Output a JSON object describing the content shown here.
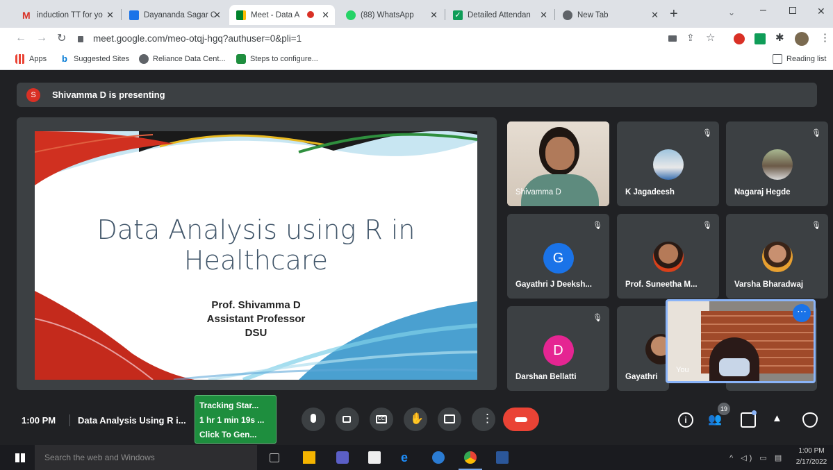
{
  "browser": {
    "tabs": [
      {
        "label": "induction TT for yo",
        "icon": "gmail-icon",
        "color": "#d93025"
      },
      {
        "label": "Dayananda Sagar C",
        "icon": "calendar-icon",
        "color": "#1a73e8"
      },
      {
        "label": "Meet - Data A",
        "icon": "meet-icon",
        "color": "#00832d"
      },
      {
        "label": "(88) WhatsApp",
        "icon": "whatsapp-icon",
        "color": "#25d366"
      },
      {
        "label": "Detailed Attendan",
        "icon": "check-icon",
        "color": "#0f9d58"
      },
      {
        "label": "New Tab",
        "icon": "chrome-icon",
        "color": "#5f6368"
      }
    ],
    "url": "meet.google.com/meo-otqj-hgq?authuser=0&pli=1",
    "bookmarks": [
      "Apps",
      "Suggested Sites",
      "Reliance Data Cent...",
      "Steps to configure..."
    ],
    "reading_list": "Reading list"
  },
  "meet": {
    "presenting_banner": "Shivamma D is presenting",
    "presenter_initial": "S",
    "slide": {
      "title_line1": "Data Analysis using R in",
      "title_line2": "Healthcare",
      "author": "Prof. Shivamma D",
      "role": "Assistant Professor",
      "org": "DSU"
    },
    "participants": [
      {
        "name": "Shivamma D",
        "type": "video",
        "muted": false
      },
      {
        "name": "K Jagadeesh",
        "type": "photo",
        "muted": true
      },
      {
        "name": "Nagaraj Hegde",
        "type": "photo",
        "muted": true
      },
      {
        "name": "Gayathri J Deeksh...",
        "type": "letter",
        "letter": "G",
        "color": "#1a73e8",
        "muted": true
      },
      {
        "name": "Prof. Suneetha M...",
        "type": "photo",
        "muted": true
      },
      {
        "name": "Varsha Bharadwaj",
        "type": "photo",
        "muted": true
      },
      {
        "name": "Darshan Bellatti",
        "type": "letter",
        "letter": "D",
        "color": "#e52592",
        "muted": true
      },
      {
        "name": "Gayathri",
        "type": "photo",
        "muted": false
      }
    ],
    "self_label": "You",
    "time": "1:00 PM",
    "meeting_title": "Data Analysis Using R i...",
    "tracker": {
      "line1": "Tracking Star...",
      "line2": "1 hr 1 min 19s ...",
      "line3": "Click To Gen..."
    },
    "participant_count": "19"
  },
  "taskbar": {
    "search_placeholder": "Search the web and Windows",
    "time": "1:00 PM",
    "date": "2/17/2022"
  }
}
